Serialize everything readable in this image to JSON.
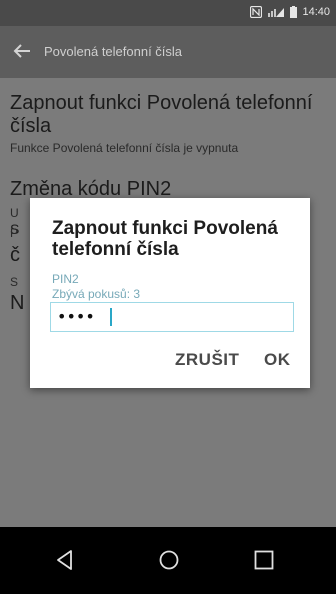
{
  "statusbar": {
    "time": "14:40",
    "icons": [
      "nfc-icon",
      "signal-icon",
      "battery-icon"
    ]
  },
  "appbar": {
    "title": "Povolená telefonní čísla",
    "back_icon": "arrow-back-icon"
  },
  "preferences": [
    {
      "title": "Zapnout funkci Povolená telefonní čísla",
      "summary": "Funkce Povolená telefonní čísla je vypnuta"
    },
    {
      "title": "Změna kódu PIN2",
      "summary": "U"
    },
    {
      "title": "S",
      "summary": "P"
    },
    {
      "title": "č",
      "summary": "S"
    },
    {
      "title": "N",
      "summary": ""
    }
  ],
  "dialog": {
    "title": "Zapnout funkci Povolená telefonní čísla",
    "label": "PIN2",
    "attempts": "Zbývá pokusů: 3",
    "input_value": "••••",
    "cancel_label": "ZRUŠIT",
    "ok_label": "OK"
  },
  "navbar": {
    "back": "back-triangle-icon",
    "home": "home-circle-icon",
    "recents": "recents-square-icon"
  }
}
